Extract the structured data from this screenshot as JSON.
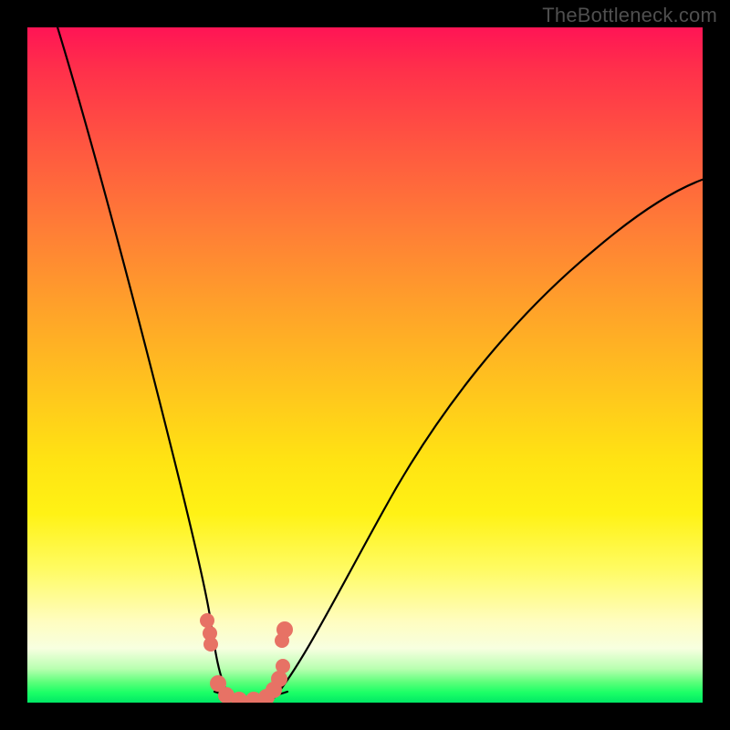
{
  "attribution": "TheBottleneck.com",
  "colors": {
    "background": "#000000",
    "gradient_top": "#ff1455",
    "gradient_mid_upper": "#ff7e36",
    "gradient_mid": "#ffe313",
    "gradient_lower": "#fffdc0",
    "gradient_bottom": "#00e865",
    "curve_stroke": "#000000",
    "marker_fill": "#e77265"
  },
  "chart_data": {
    "type": "line",
    "title": "",
    "xlabel": "",
    "ylabel": "",
    "xlim": [
      0,
      100
    ],
    "ylim": [
      0,
      100
    ],
    "series": [
      {
        "name": "left-curve",
        "x": [
          4,
          6,
          8,
          10,
          12,
          14,
          16,
          18,
          20,
          22,
          24,
          26,
          27.5,
          28.5
        ],
        "y": [
          100,
          90,
          80,
          70,
          60,
          50,
          41,
          33,
          25,
          18,
          11,
          5,
          1,
          0
        ]
      },
      {
        "name": "right-curve",
        "x": [
          36,
          38,
          40,
          43,
          46,
          50,
          55,
          60,
          66,
          73,
          81,
          90,
          100
        ],
        "y": [
          0,
          2,
          5,
          10,
          16,
          23,
          31,
          39,
          47,
          55,
          63,
          71,
          78
        ]
      },
      {
        "name": "valley-floor",
        "x": [
          26,
          30,
          33,
          36
        ],
        "y": [
          1.5,
          0,
          0,
          1.5
        ]
      }
    ],
    "markers": [
      {
        "x": 26.5,
        "y": 12
      },
      {
        "x": 27.0,
        "y": 10
      },
      {
        "x": 27.2,
        "y": 8.5
      },
      {
        "x": 28.3,
        "y": 2.5
      },
      {
        "x": 29.5,
        "y": 0.5
      },
      {
        "x": 31.0,
        "y": 0
      },
      {
        "x": 33.0,
        "y": 0.5
      },
      {
        "x": 35.0,
        "y": 2
      },
      {
        "x": 35.8,
        "y": 4
      },
      {
        "x": 36.5,
        "y": 6
      },
      {
        "x": 37.5,
        "y": 12
      },
      {
        "x": 37.0,
        "y": 10.5
      }
    ],
    "annotations": []
  }
}
